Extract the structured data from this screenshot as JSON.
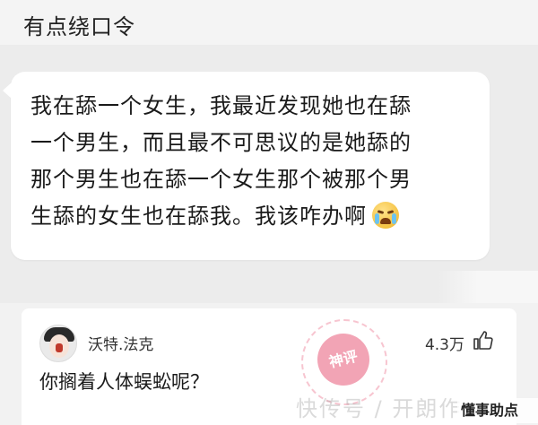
{
  "header": {
    "title": "有点绕口令"
  },
  "post": {
    "lines": [
      "我在舔一个女生，我最近发现她也在舔",
      "一个男生，而且最不可思议的是她舔的",
      "那个男生也在舔一个女生那个被那个男",
      "生舔的女生也在舔我。我该咋办啊"
    ],
    "emoji": "crying-face"
  },
  "comment": {
    "username": "沃特.法克",
    "likes": "4.3万",
    "text": "你搁着人体蜈蚣呢？",
    "like_icon": "thumbs-up-icon"
  },
  "overlay": {
    "stamp": "神评",
    "watermark": "快传号 / 开朗作",
    "brand": "懂事助点"
  },
  "colors": {
    "background": "#f2f2f2",
    "bubble": "#ffffff",
    "stamp": "#e75a78"
  }
}
